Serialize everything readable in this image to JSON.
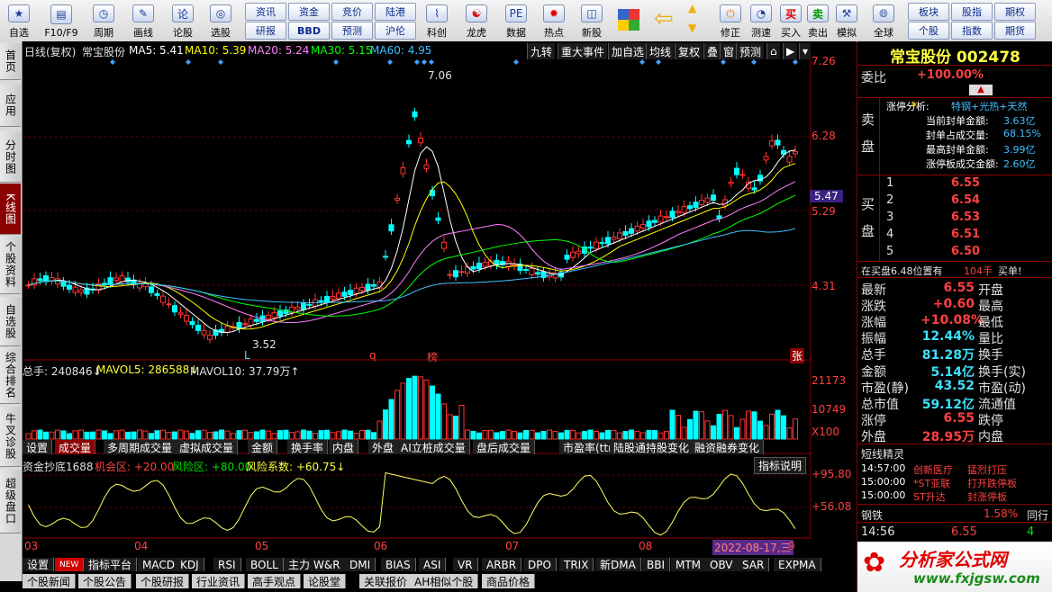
{
  "toolbar": {
    "items": [
      {
        "label": "自选",
        "icon": "star-icon"
      },
      {
        "label": "F10/F9",
        "icon": "f10-icon"
      },
      {
        "label": "周期",
        "icon": "clock-icon"
      },
      {
        "label": "画线",
        "icon": "pen-icon"
      },
      {
        "label": "论股",
        "icon": "lun-icon"
      },
      {
        "label": "选股",
        "icon": "select-stock-icon"
      }
    ],
    "buttons_top": [
      "资讯",
      "资金",
      "竞价",
      "陆港"
    ],
    "buttons_bottom": [
      "研报",
      "BBD",
      "预测",
      "沪伦"
    ],
    "items2": [
      {
        "label": "科创",
        "icon": "chart-icon"
      },
      {
        "label": "龙虎",
        "icon": "dragon-icon"
      },
      {
        "label": "数据",
        "icon": "pe-icon"
      },
      {
        "label": "热点",
        "icon": "hot-icon"
      },
      {
        "label": "新股",
        "icon": "ipo-icon"
      }
    ],
    "items3": [
      {
        "label": "后退",
        "icon": "back-arrow-icon"
      },
      {
        "label": "修正",
        "icon": "fix-icon"
      },
      {
        "label": "测速",
        "icon": "speed-icon"
      },
      {
        "label": "买入",
        "icon": "buy-icon",
        "glyph": "买"
      },
      {
        "label": "卖出",
        "icon": "sell-icon",
        "glyph": "卖"
      },
      {
        "label": "模拟",
        "icon": "hammer-icon"
      },
      {
        "label": "全球",
        "icon": "globe-icon"
      }
    ],
    "right_buttons_top": [
      "板块",
      "股指",
      "期权"
    ],
    "right_buttons_bottom": [
      "个股",
      "指数",
      "期货"
    ]
  },
  "left_tabs": [
    "首页",
    "应用",
    "分时图",
    "K线图",
    "个股资料",
    "自选股",
    "综合排名",
    "牛叉诊股",
    "超级盘口"
  ],
  "chart": {
    "header": {
      "period": "日线(复权)",
      "name": "常宝股份",
      "ma5": "MA5: 5.41",
      "ma10": "MA10: 5.39",
      "ma20": "MA20: 5.24",
      "ma30": "MA30: 5.15",
      "ma60": "MA60: 4.95"
    },
    "pills": [
      "九转",
      "重大事件",
      "加自选",
      "均线",
      "复权",
      "叠",
      "窗",
      "预测"
    ],
    "price_axis": [
      "7.26",
      "6.28",
      "5.47",
      "5.29",
      "4.31"
    ],
    "high_label": "7.06",
    "low_label": "3.52",
    "markers": [
      "L",
      "q",
      "榜",
      "张"
    ],
    "volume_header": {
      "total": "总手: 240846↓",
      "mavol5": "MAVOL5: 286588↓",
      "mavol10": "MAVOL10: 37.79万↑"
    },
    "volume_axis": [
      "21173",
      "10749",
      "X100"
    ],
    "sub_tabs": [
      "设置",
      "成交量",
      "多周期成交量",
      "虚拟成交量",
      "金额",
      "换手率",
      "内盘",
      "外盘",
      "AI立桩成交量",
      "盘后成交量",
      "市盈率(ttm)",
      "陆股通持股变化",
      "融资融券变化"
    ],
    "indicator_header": {
      "name": "资金抄底1688",
      "jihui": "机会区: +20.00",
      "fengxian": "风险区: +80.00",
      "coef": "风险系数: +60.75↓"
    },
    "indicator_button": "指标说明",
    "indicator_axis": [
      "+95.80",
      "+56.08"
    ],
    "months": [
      "03",
      "04",
      "05",
      "06",
      "07",
      "08"
    ],
    "date_label": "2022-08-17,三",
    "date_tail": "9"
  },
  "bottom_tabs": [
    "设置",
    "NEW",
    "指标平台",
    "MACD",
    "KDJ",
    "RSI",
    "BOLL",
    "主力",
    "W&R",
    "DMI",
    "BIAS",
    "ASI",
    "VR",
    "ARBR",
    "DPO",
    "TRIX",
    "新DMA",
    "BBI",
    "MTM",
    "OBV",
    "SAR",
    "EXPMA"
  ],
  "bottom_tabs2": [
    "个股新闻",
    "个股公告",
    "个股研报",
    "行业资讯",
    "高手观点",
    "论股堂",
    "关联报价",
    "AH相似个股",
    "商品价格"
  ],
  "right": {
    "title": "常宝股份 002478",
    "weibi_label": "委比",
    "weibi_value": "+100.00%",
    "sell_label": "卖盘",
    "limit_title": "涨停分析:",
    "limit_tags": "特钢+光热+天然",
    "limit_rows": [
      {
        "k": "当前封单金额:",
        "v": "3.63亿"
      },
      {
        "k": "封单占成交量:",
        "v": "68.15%"
      },
      {
        "k": "最高封单金额:",
        "v": "3.99亿"
      },
      {
        "k": "涨停板成交金额:",
        "v": "2.60亿"
      }
    ],
    "buy_label": "买盘",
    "buy_levels": [
      {
        "n": "1",
        "p": "6.55"
      },
      {
        "n": "2",
        "p": "6.54"
      },
      {
        "n": "3",
        "p": "6.53"
      },
      {
        "n": "4",
        "p": "6.51"
      },
      {
        "n": "5",
        "p": "6.50"
      }
    ],
    "queue_text": "在买盘6.48位置有",
    "queue_count": "104手",
    "queue_tail": "买单!",
    "stats": [
      {
        "k1": "最新",
        "v1": "6.55",
        "k2": "开盘",
        "v2": ""
      },
      {
        "k1": "涨跌",
        "v1": "+0.60",
        "k2": "最高",
        "v2": ""
      },
      {
        "k1": "涨幅",
        "v1": "+10.08%",
        "k2": "最低",
        "v2": ""
      },
      {
        "k1": "振幅",
        "v1": "12.44%",
        "k2": "量比",
        "v2": ""
      },
      {
        "k1": "总手",
        "v1": "81.28万",
        "k2": "换手",
        "v2": ""
      },
      {
        "k1": "金额",
        "v1": "5.14亿",
        "k2": "换手(实)",
        "v2": ""
      },
      {
        "k1": "市盈(静)",
        "v1": "43.52",
        "k2": "市盈(动)",
        "v2": ""
      },
      {
        "k1": "总市值",
        "v1": "59.12亿",
        "k2": "流通值",
        "v2": ""
      },
      {
        "k1": "涨停",
        "v1": "6.55",
        "k2": "跌停",
        "v2": ""
      },
      {
        "k1": "外盘",
        "v1": "28.95万",
        "k2": "内盘",
        "v2": ""
      }
    ],
    "short_title": "短线精灵",
    "short_rows": [
      {
        "t": "14:57:00",
        "n": "创新医疗",
        "e": "猛烈打压"
      },
      {
        "t": "15:00:00",
        "n": "*ST亚联",
        "e": "打开跌停板"
      },
      {
        "t": "15:00:00",
        "n": "ST升达",
        "e": "封涨停板"
      }
    ],
    "industry": "钢铁",
    "industry_pct": "1.58%",
    "industry_tail": "同行",
    "last_time": "14:56",
    "last_price": "6.55",
    "last_vol": "4",
    "watermark": "分析家公式网",
    "watermark_url": "www.fxjgsw.com"
  },
  "colors": {
    "up": "#ff3232",
    "down": "#00ffff",
    "ma5": "#ffffff",
    "ma10": "#ffff00",
    "ma20": "#ff80ff",
    "ma30": "#00ff00",
    "ma60": "#40c0ff"
  }
}
